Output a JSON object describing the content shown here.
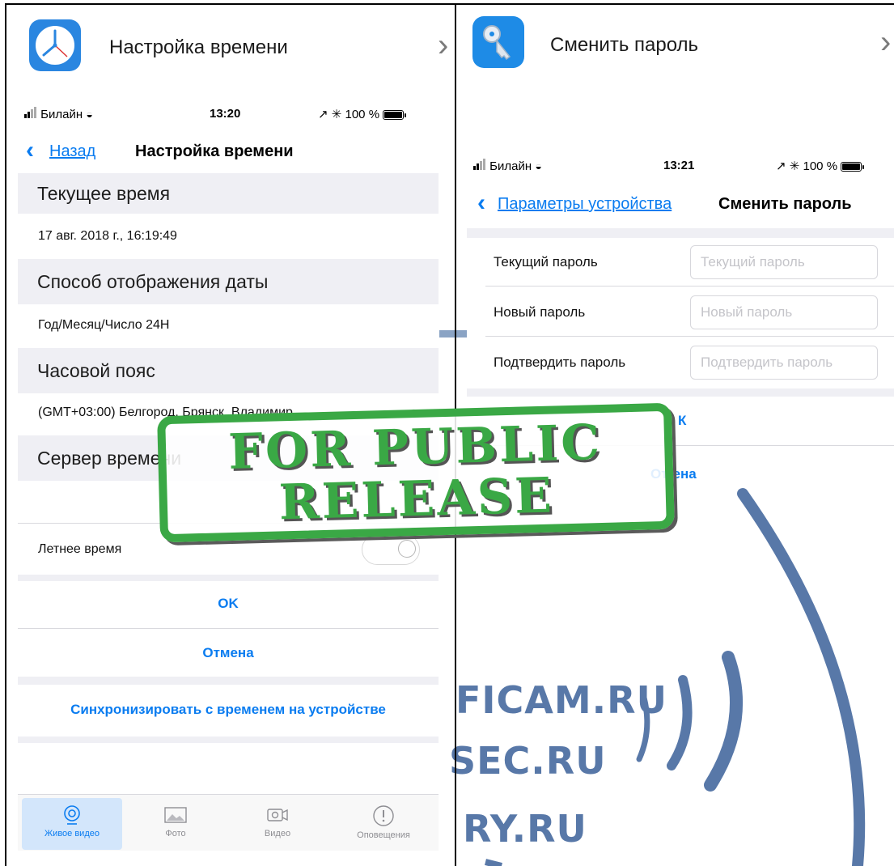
{
  "left": {
    "header": {
      "title": "Настройка времени",
      "chevron": "›",
      "icon": "clock-icon"
    },
    "status": {
      "carrier": "Билайн",
      "time": "13:20",
      "battery": "100 %"
    },
    "nav": {
      "back": "Назад",
      "back_chevron": "‹",
      "title": "Настройка времени"
    },
    "sections": {
      "current_time_title": "Текущее время",
      "current_time_value": "17 авг. 2018 г., 16:19:49",
      "date_format_title": "Способ отображения даты",
      "date_format_value": "Год/Месяц/Число 24Н",
      "timezone_title": "Часовой пояс",
      "timezone_value": "(GMT+03:00) Белгород, Брянск, Владимир",
      "time_server_title": "Сервер времени",
      "dst_label": "Летнее время"
    },
    "dst_enabled": false,
    "actions": {
      "ok": "OK",
      "cancel": "Отмена",
      "sync": "Синхронизировать с временем на устройстве"
    },
    "tabs": [
      {
        "label": "Живое видео",
        "icon": "live-video-icon",
        "active": true
      },
      {
        "label": "Фото",
        "icon": "photo-icon",
        "active": false
      },
      {
        "label": "Видео",
        "icon": "video-camera-icon",
        "active": false
      },
      {
        "label": "Оповещения",
        "icon": "alert-icon",
        "active": false
      }
    ]
  },
  "right": {
    "header": {
      "title": "Сменить пароль",
      "chevron": "›",
      "icon": "key-icon"
    },
    "status": {
      "carrier": "Билайн",
      "time": "13:21",
      "battery": "100 %"
    },
    "nav": {
      "back": "Параметры устройства",
      "back_chevron": "‹",
      "title": "Сменить пароль"
    },
    "form": {
      "current_label": "Текущий пароль",
      "current_placeholder": "Текущий пароль",
      "new_label": "Новый пароль",
      "new_placeholder": "Новый пароль",
      "confirm_label": "Подтвердить пароль",
      "confirm_placeholder": "Подтвердить пароль"
    },
    "actions": {
      "ok_partial": "К",
      "cancel_left": "От",
      "cancel_right": "ена"
    }
  },
  "stamp": {
    "line1": "FOR PUBLIC",
    "line2": "RELEASE"
  },
  "watermark": {
    "line1": "FICAM.RU",
    "line2": "SEC.RU",
    "line3": "RY.RU"
  },
  "colors": {
    "accent": "#0a7cf0",
    "stamp_green": "#3aa845",
    "watermark_blue": "#5878a8",
    "section_gray": "#efeff4"
  }
}
